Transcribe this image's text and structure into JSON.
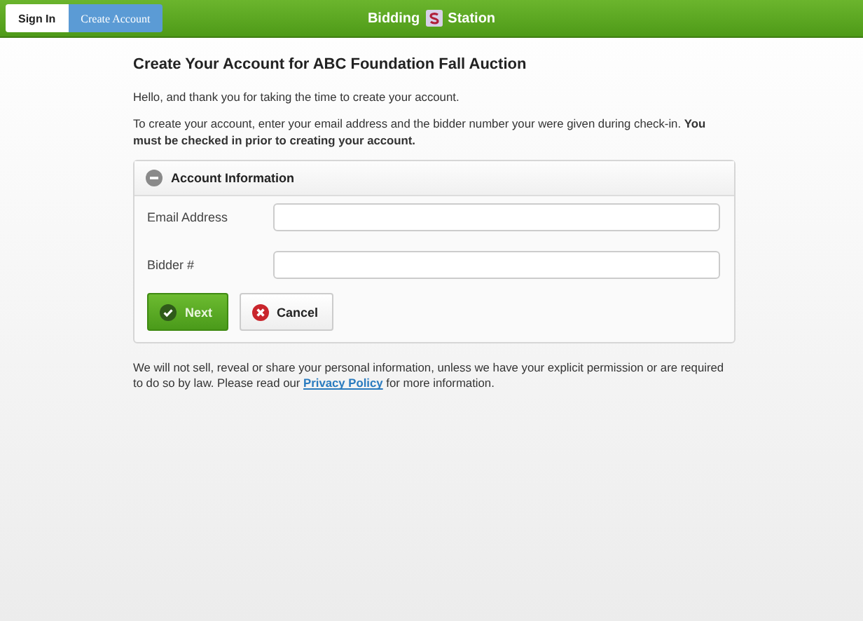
{
  "header": {
    "tabs": [
      {
        "label": "Sign In",
        "selected": false
      },
      {
        "label": "Create Account",
        "selected": true
      }
    ],
    "brand": {
      "before": "Bidding",
      "after": "Station"
    }
  },
  "title": "Create Your Account for ABC Foundation Fall Auction",
  "paragraphs": [
    "Hello, and thank you for taking the time to create your account.",
    "To create your account, enter your email address and the bidder number your were given during check-in. **You must be checked in prior to creating your account.**"
  ],
  "panel": {
    "title": "Account Information",
    "expanded": true,
    "fields": [
      {
        "label": "Email Address"
      },
      {
        "label": "Bidder #"
      }
    ],
    "buttons": [
      {
        "label": "Next",
        "kind": "primary"
      },
      {
        "label": "Cancel",
        "kind": "cancel"
      }
    ]
  },
  "notice": {
    "before": "We will not sell, reveal or share your personal information, unless we have your explicit permission or are required to do so by law. Please read our",
    "link": "Privacy Policy",
    "after": "for more information."
  }
}
